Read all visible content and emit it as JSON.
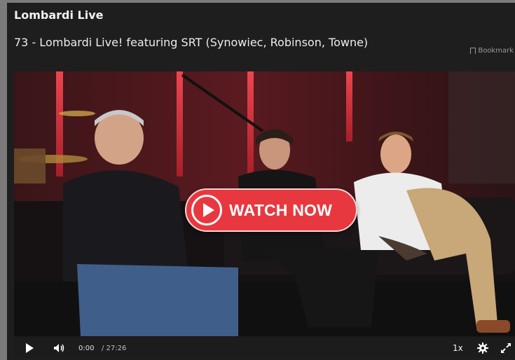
{
  "header": {
    "app_title": "Lombardi Live",
    "episode_title": "73 - Lombardi Live! featuring SRT (Synowiec, Robinson, Towne)",
    "bookmark_label": "Bookmark"
  },
  "player": {
    "watch_label": "WATCH NOW",
    "current_time": "0:00",
    "total_time": "/ 27:26",
    "speed": "1x"
  }
}
